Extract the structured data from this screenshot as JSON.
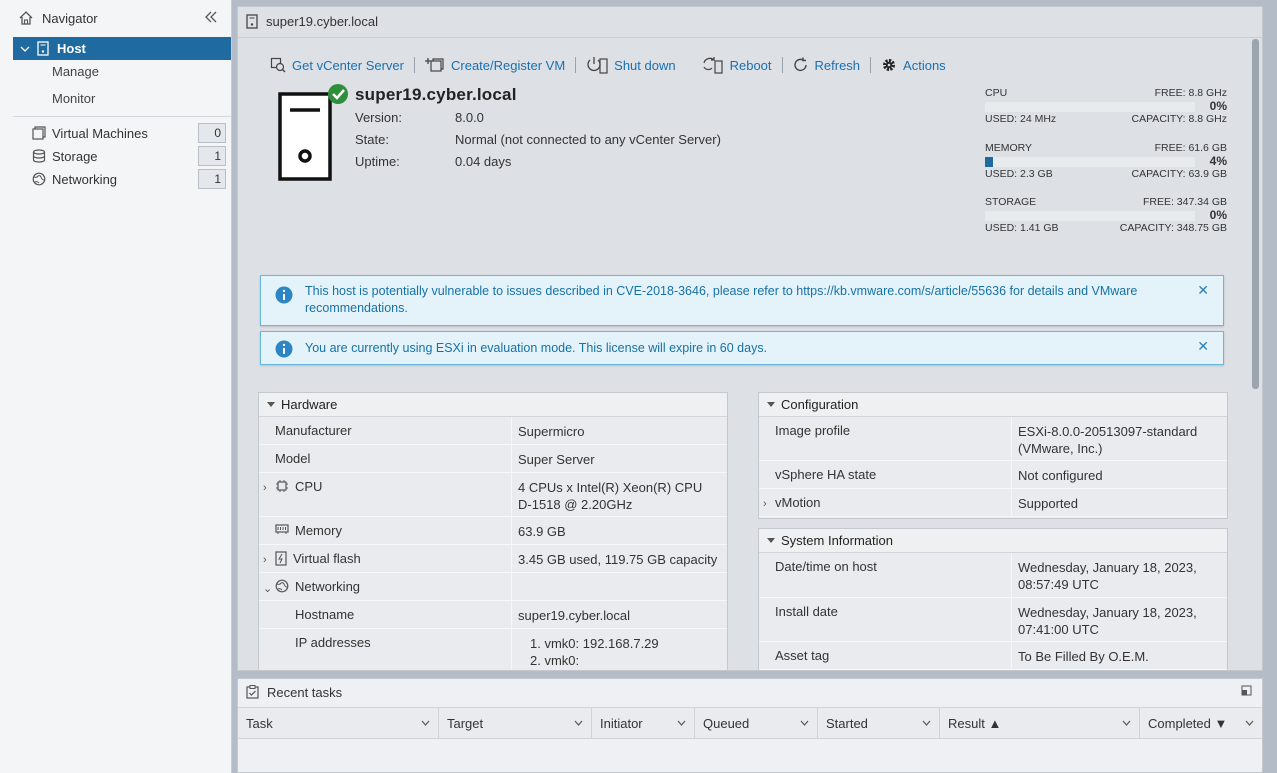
{
  "navigator": {
    "title": "Navigator",
    "host": "Host",
    "host_children": [
      "Manage",
      "Monitor"
    ],
    "items": [
      {
        "label": "Virtual Machines",
        "count": "0"
      },
      {
        "label": "Storage",
        "count": "1"
      },
      {
        "label": "Networking",
        "count": "1"
      }
    ]
  },
  "panel": {
    "title": "super19.cyber.local",
    "toolbar": {
      "get_vcenter": "Get vCenter Server",
      "create_vm": "Create/Register VM",
      "shutdown": "Shut down",
      "reboot": "Reboot",
      "refresh": "Refresh",
      "actions": "Actions"
    },
    "host": {
      "name": "super19.cyber.local",
      "version_label": "Version:",
      "version": "8.0.0",
      "state_label": "State:",
      "state": "Normal (not connected to any vCenter Server)",
      "uptime_label": "Uptime:",
      "uptime": "0.04 days"
    },
    "resources": [
      {
        "name": "CPU",
        "free": "FREE: 8.8 GHz",
        "pct": "0%",
        "used": "USED: 24 MHz",
        "capacity": "CAPACITY: 8.8 GHz",
        "fraction": 0.0
      },
      {
        "name": "MEMORY",
        "free": "FREE: 61.6 GB",
        "pct": "4%",
        "used": "USED: 2.3 GB",
        "capacity": "CAPACITY: 63.9 GB",
        "fraction": 0.04
      },
      {
        "name": "STORAGE",
        "free": "FREE: 347.34 GB",
        "pct": "0%",
        "used": "USED: 1.41 GB",
        "capacity": "CAPACITY: 348.75 GB",
        "fraction": 0.0
      }
    ],
    "alerts": [
      "This host is potentially vulnerable to issues described in CVE-2018-3646, please refer to https://kb.vmware.com/s/article/55636 for details and VMware recommendations.",
      "You are currently using ESXi in evaluation mode. This license will expire in 60 days."
    ],
    "hardware": {
      "title": "Hardware",
      "rows": [
        {
          "k": "Manufacturer",
          "v": "Supermicro"
        },
        {
          "k": "Model",
          "v": "Super Server"
        },
        {
          "k": "CPU",
          "v": "4 CPUs x Intel(R) Xeon(R) CPU D-1518 @ 2.20GHz"
        },
        {
          "k": "Memory",
          "v": "63.9 GB"
        },
        {
          "k": "Virtual flash",
          "v": "3.45 GB used, 119.75 GB capacity"
        },
        {
          "k": "Networking",
          "v": ""
        },
        {
          "k": "Hostname",
          "v": "super19.cyber.local"
        },
        {
          "k": "IP addresses",
          "v1": "1. vmk0: 192.168.7.29",
          "v2": "2. vmk0:"
        }
      ]
    },
    "configuration": {
      "title": "Configuration",
      "rows": [
        {
          "k": "Image profile",
          "v": "ESXi-8.0.0-20513097-standard (VMware, Inc.)"
        },
        {
          "k": "vSphere HA state",
          "v": "Not configured"
        },
        {
          "k": "vMotion",
          "v": "Supported"
        }
      ]
    },
    "system_info": {
      "title": "System Information",
      "rows": [
        {
          "k": "Date/time on host",
          "v": "Wednesday, January 18, 2023, 08:57:49 UTC"
        },
        {
          "k": "Install date",
          "v": "Wednesday, January 18, 2023, 07:41:00 UTC"
        },
        {
          "k": "Asset tag",
          "v": "To Be Filled By O.E.M."
        }
      ]
    }
  },
  "tasks": {
    "title": "Recent tasks",
    "columns": [
      "Task",
      "Target",
      "Initiator",
      "Queued",
      "Started",
      "Result ▲",
      "Completed ▼"
    ]
  }
}
